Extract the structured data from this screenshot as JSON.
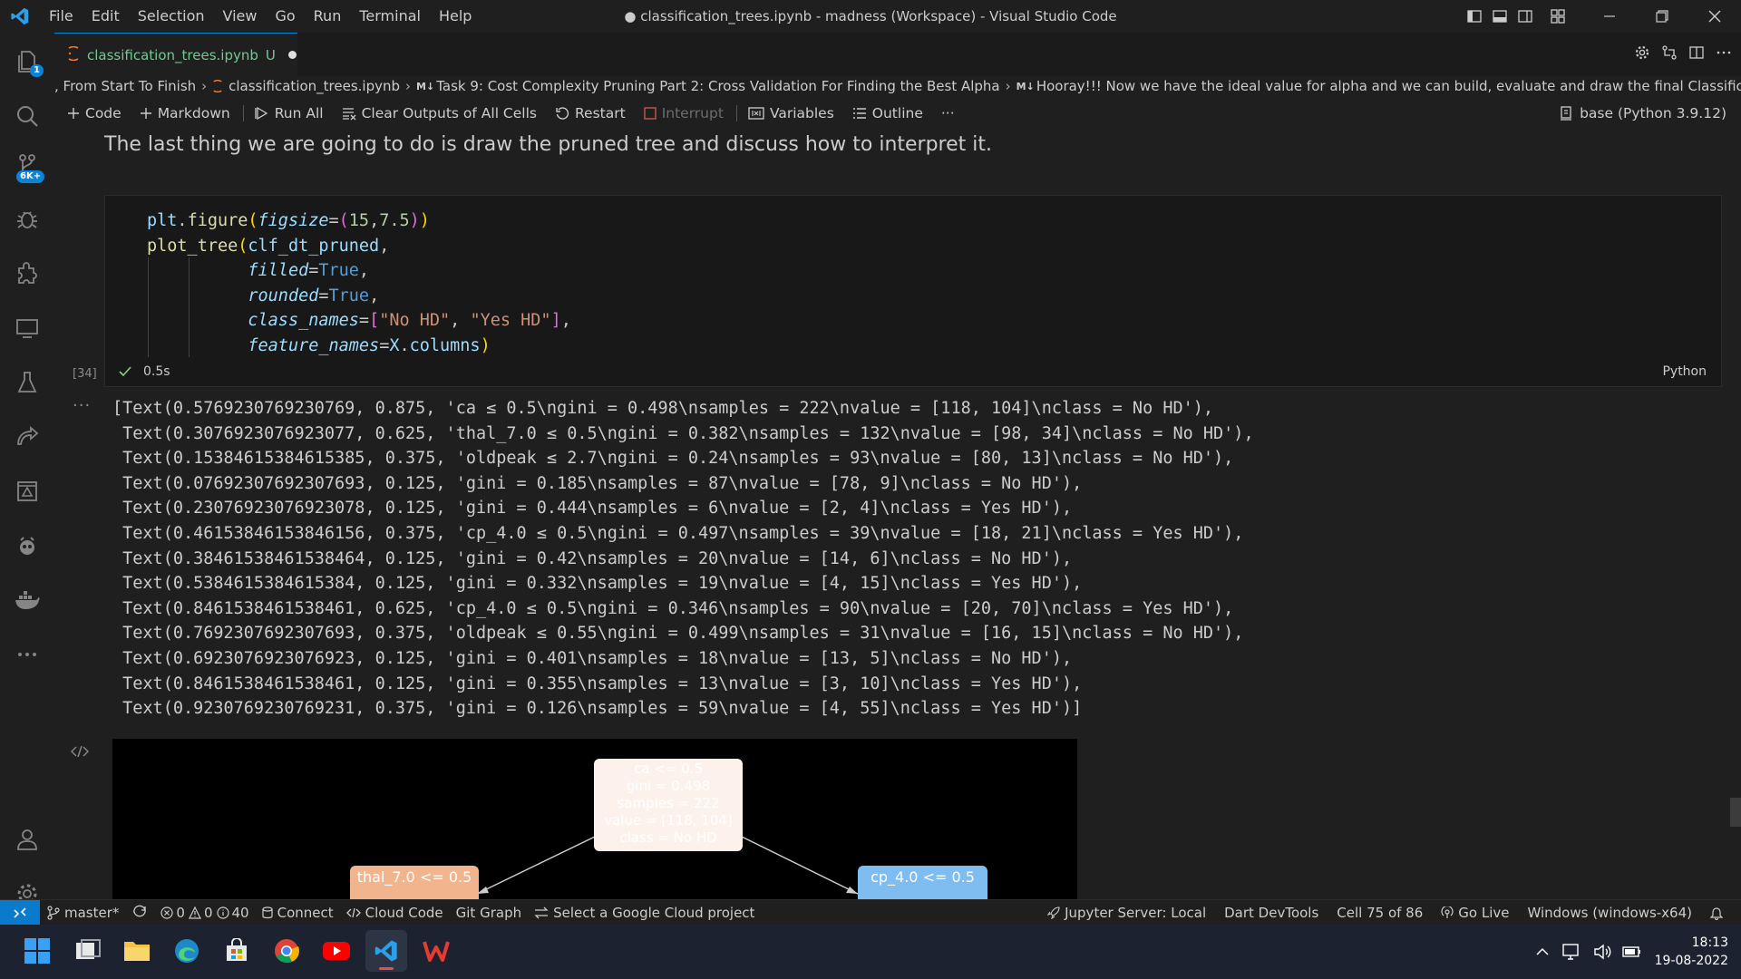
{
  "window": {
    "title": "● classification_trees.ipynb - madness (Workspace) - Visual Studio Code",
    "menu": [
      "File",
      "Edit",
      "Selection",
      "View",
      "Go",
      "Run",
      "Terminal",
      "Help"
    ]
  },
  "activity": {
    "explorer_badge": "1",
    "source_control_badge": "6K+"
  },
  "tab": {
    "name": "classification_trees.ipynb",
    "status": "U"
  },
  "breadcrumb": {
    "items": [
      ", From Start To Finish",
      "classification_trees.ipynb",
      "Task 9: Cost Complexity Pruning Part 2: Cross Validation For Finding the Best Alpha",
      "Hooray!!! Now we have the ideal value for alpha and we can build, evaluate and draw the final Classification Tree."
    ],
    "md_marker": "M↓"
  },
  "toolbar": {
    "code": "Code",
    "markdown": "Markdown",
    "run_all": "Run All",
    "clear_outputs": "Clear Outputs of All Cells",
    "restart": "Restart",
    "interrupt": "Interrupt",
    "variables": "Variables",
    "outline": "Outline",
    "more": "···",
    "kernel": "base (Python 3.9.12)"
  },
  "markdown_cell": {
    "text": "The last thing we are going to do is draw the pruned tree and discuss how to interpret it."
  },
  "code_cell": {
    "execution_count": "[34]",
    "exec_time": "0.5s",
    "language": "Python"
  },
  "output": {
    "dots": "···",
    "lines": [
      "[Text(0.5769230769230769, 0.875, 'ca ≤ 0.5\\ngini = 0.498\\nsamples = 222\\nvalue = [118, 104]\\nclass = No HD'),",
      " Text(0.3076923076923077, 0.625, 'thal_7.0 ≤ 0.5\\ngini = 0.382\\nsamples = 132\\nvalue = [98, 34]\\nclass = No HD'),",
      " Text(0.15384615384615385, 0.375, 'oldpeak ≤ 2.7\\ngini = 0.24\\nsamples = 93\\nvalue = [80, 13]\\nclass = No HD'),",
      " Text(0.07692307692307693, 0.125, 'gini = 0.185\\nsamples = 87\\nvalue = [78, 9]\\nclass = No HD'),",
      " Text(0.23076923076923078, 0.125, 'gini = 0.444\\nsamples = 6\\nvalue = [2, 4]\\nclass = Yes HD'),",
      " Text(0.46153846153846156, 0.375, 'cp_4.0 ≤ 0.5\\ngini = 0.497\\nsamples = 39\\nvalue = [18, 21]\\nclass = Yes HD'),",
      " Text(0.38461538461538464, 0.125, 'gini = 0.42\\nsamples = 20\\nvalue = [14, 6]\\nclass = No HD'),",
      " Text(0.5384615384615384, 0.125, 'gini = 0.332\\nsamples = 19\\nvalue = [4, 15]\\nclass = Yes HD'),",
      " Text(0.8461538461538461, 0.625, 'cp_4.0 ≤ 0.5\\ngini = 0.346\\nsamples = 90\\nvalue = [20, 70]\\nclass = Yes HD'),",
      " Text(0.7692307692307693, 0.375, 'oldpeak ≤ 0.55\\ngini = 0.499\\nsamples = 31\\nvalue = [16, 15]\\nclass = No HD'),",
      " Text(0.6923076923076923, 0.125, 'gini = 0.401\\nsamples = 18\\nvalue = [13, 5]\\nclass = No HD'),",
      " Text(0.8461538461538461, 0.125, 'gini = 0.355\\nsamples = 13\\nvalue = [3, 10]\\nclass = Yes HD'),",
      " Text(0.9230769230769231, 0.375, 'gini = 0.126\\nsamples = 59\\nvalue = [4, 55]\\nclass = Yes HD')]"
    ]
  },
  "tree": {
    "root": [
      "ca <= 0.5",
      "gini = 0.498",
      "samples = 222",
      "value = [118, 104]",
      "class = No HD"
    ],
    "left": [
      "thal_7.0 <= 0.5"
    ],
    "right": [
      "cp_4.0 <= 0.5"
    ],
    "colors": {
      "root": "#fdf2eb",
      "left": "#f2b48d",
      "right": "#7fbcf0"
    }
  },
  "statusbar": {
    "branch": "master*",
    "errors": "0",
    "warnings": "0",
    "info": "40",
    "connect": "Connect",
    "cloud_code": "Cloud Code",
    "git_graph": "Git Graph",
    "gcp": "Select a Google Cloud project",
    "jupyter": "Jupyter Server: Local",
    "dart": "Dart DevTools",
    "cell": "Cell 75 of 86",
    "golive": "Go Live",
    "platform": "Windows (windows-x64)"
  },
  "taskbar": {
    "time": "18:13",
    "date": "19-08-2022"
  },
  "colors": {
    "accent": "#0a84d8",
    "untracked": "#73c991"
  }
}
